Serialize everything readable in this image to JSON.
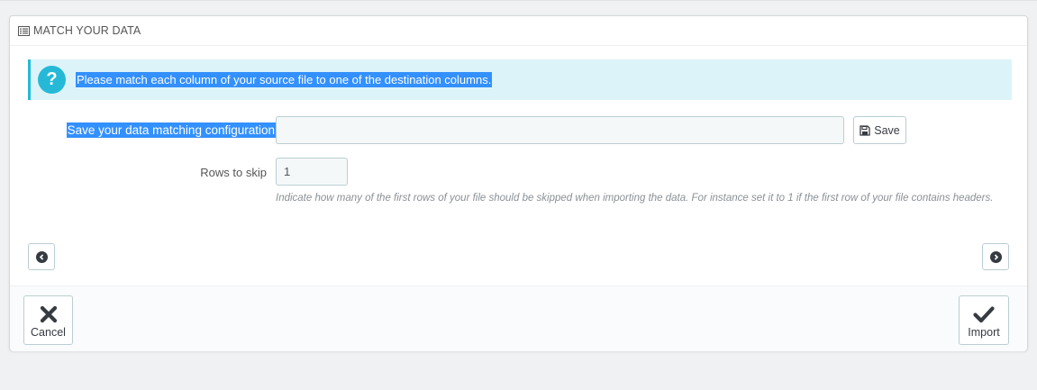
{
  "panel": {
    "title": "MATCH YOUR DATA",
    "title_icon": "list-icon"
  },
  "alert": {
    "icon": "question-icon",
    "text": "Please match each column of your source file to one of the destination columns."
  },
  "form": {
    "save_config_label": "Save your data matching configuration",
    "save_config_value": "",
    "save_button_label": "Save",
    "rows_to_skip_label": "Rows to skip",
    "rows_to_skip_value": "1",
    "rows_to_skip_help": "Indicate how many of the first rows of your file should be skipped when importing the data. For instance set it to 1 if the first row of your file contains headers."
  },
  "navigation": {
    "prev_icon": "chevron-left-circle-icon",
    "next_icon": "chevron-right-circle-icon"
  },
  "footer": {
    "cancel_label": "Cancel",
    "import_label": "Import"
  },
  "colors": {
    "accent": "#25b9d7",
    "alert_bg": "#dcf4f9",
    "selection": "#3390ff",
    "page_bg": "#eff1f2"
  }
}
